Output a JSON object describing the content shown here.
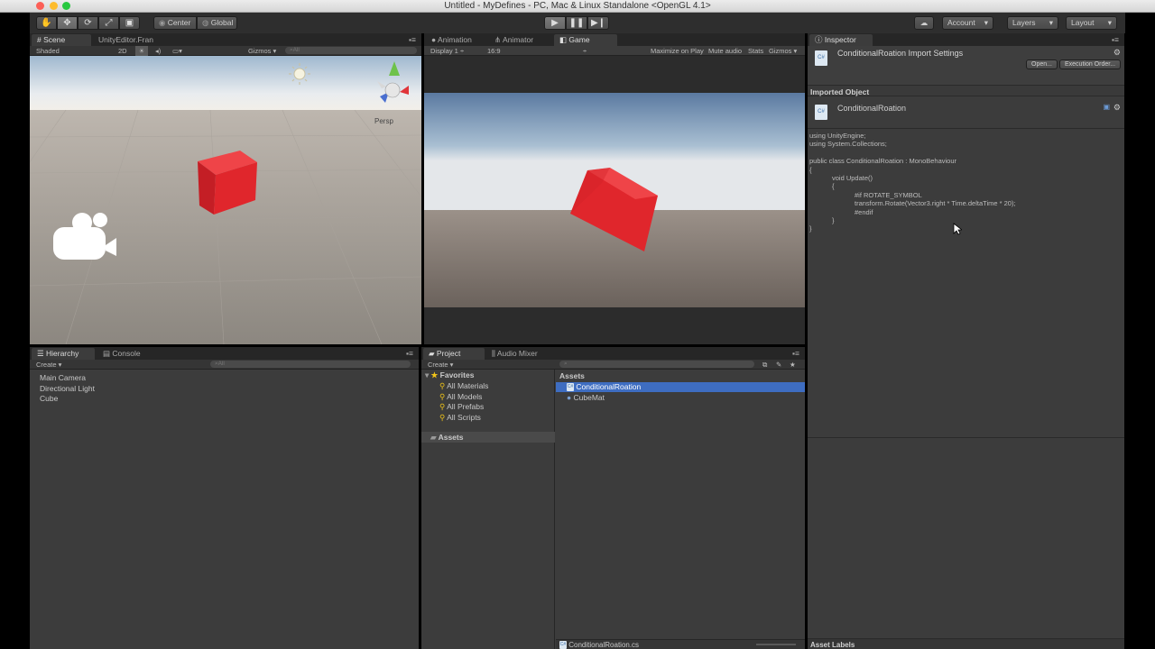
{
  "window": {
    "title": "Untitled - MyDefines - PC, Mac & Linux Standalone <OpenGL 4.1>"
  },
  "toolbar": {
    "pivot_label": "Center",
    "space_label": "Global",
    "account_label": "Account",
    "layers_label": "Layers",
    "layout_label": "Layout"
  },
  "scene": {
    "tab_label": "Scene",
    "tab2_label": "UnityEditor.Fran",
    "shading_mode": "Shaded",
    "mode_2d": "2D",
    "gizmos_label": "Gizmos",
    "search_placeholder": "All",
    "persp_label": "Persp"
  },
  "game": {
    "tabs": [
      "Animation",
      "Animator",
      "Game"
    ],
    "display_label": "Display 1",
    "aspect_label": "16:9",
    "maximize_label": "Maximize on Play",
    "mute_label": "Mute audio",
    "stats_label": "Stats",
    "gizmos_label": "Gizmos"
  },
  "inspector": {
    "tab_label": "Inspector",
    "header_title": "ConditionalRoation Import Settings",
    "open_button": "Open...",
    "execution_order_button": "Execution Order...",
    "imported_object_label": "Imported Object",
    "object_name": "ConditionalRoation",
    "code_lines": [
      "using UnityEngine;",
      "using System.Collections;",
      "",
      "public class ConditionalRoation : MonoBehaviour",
      "{",
      "            void Update()",
      "            {",
      "                        #if ROTATE_SYMBOL",
      "                        transform.Rotate(Vector3.right * Time.deltaTime * 20);",
      "                        #endif",
      "            }",
      "}"
    ],
    "asset_labels": "Asset Labels"
  },
  "hierarchy": {
    "tab_label": "Hierarchy",
    "console_tab_label": "Console",
    "create_label": "Create",
    "search_placeholder": "All",
    "items": [
      "Main Camera",
      "Directional Light",
      "Cube"
    ]
  },
  "project": {
    "tab_label": "Project",
    "audio_mixer_tab_label": "Audio Mixer",
    "create_label": "Create",
    "favorites_label": "Favorites",
    "favorites": [
      "All Materials",
      "All Models",
      "All Prefabs",
      "All Scripts"
    ],
    "assets_folder_label": "Assets",
    "assets_header": "Assets",
    "assets": [
      "ConditionalRoation",
      "CubeMat"
    ],
    "selected_asset_path": "ConditionalRoation.cs"
  },
  "colors": {
    "selection": "#3e6dc1",
    "cube_red": "#e0262c",
    "panel_bg": "#3c3c3c"
  }
}
